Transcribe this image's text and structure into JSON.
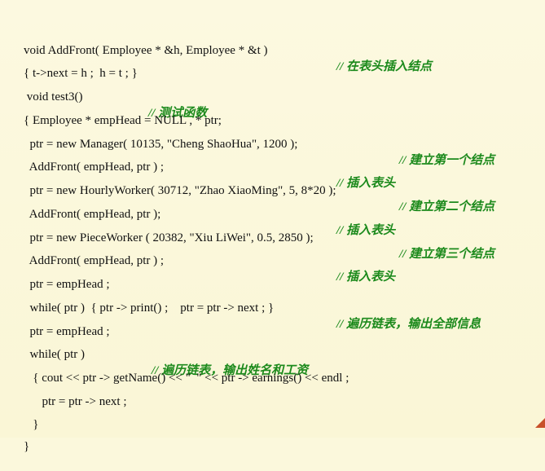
{
  "lines": [
    {
      "code": "void AddFront( Employee * &h, Employee * &t )",
      "comment": "// 在表头插入结点"
    },
    {
      "code": "{ t->next = h ;  h = t ; }",
      "comment": ""
    },
    {
      "code": " void test3()",
      "comment": "// 测试函数"
    },
    {
      "code": "{ Employee * empHead = NULL , * ptr;",
      "comment": ""
    },
    {
      "code": "  ptr = new Manager( 10135, \"Cheng ShaoHua\", 1200 );",
      "comment": "// 建立第一个结点"
    },
    {
      "code": "  AddFront( empHead, ptr ) ;",
      "comment": "// 插入表头"
    },
    {
      "code": "  ptr = new HourlyWorker( 30712, \"Zhao XiaoMing\", 5, 8*20 );",
      "comment": "// 建立第二个结点"
    },
    {
      "code": "  AddFront( empHead, ptr );",
      "comment": "// 插入表头"
    },
    {
      "code": "  ptr = new PieceWorker ( 20382, \"Xiu LiWei\", 0.5, 2850 );",
      "comment": "// 建立第三个结点"
    },
    {
      "code": "  AddFront( empHead, ptr ) ;",
      "comment": "// 插入表头"
    },
    {
      "code": "  ptr = empHead ;",
      "comment": ""
    },
    {
      "code": "  while( ptr )  { ptr -> print() ;    ptr = ptr -> next ; }",
      "comment": "// 遍历链表，输出全部信息"
    },
    {
      "code": "  ptr = empHead ;",
      "comment": ""
    },
    {
      "code": "  while( ptr )",
      "comment": "// 遍历链表，输出姓名和工资"
    },
    {
      "code": "   { cout << ptr -> getName() << \"  \" << ptr -> earnings() << endl ;",
      "comment": ""
    },
    {
      "code": "      ptr = ptr -> next ;",
      "comment": ""
    },
    {
      "code": "   }",
      "comment": ""
    },
    {
      "code": "}",
      "comment": ""
    }
  ],
  "colors": {
    "background": "#fbf8dc",
    "code_text": "#111111",
    "comment_text": "#1c8a1c",
    "corner_accent": "#c8502a"
  }
}
